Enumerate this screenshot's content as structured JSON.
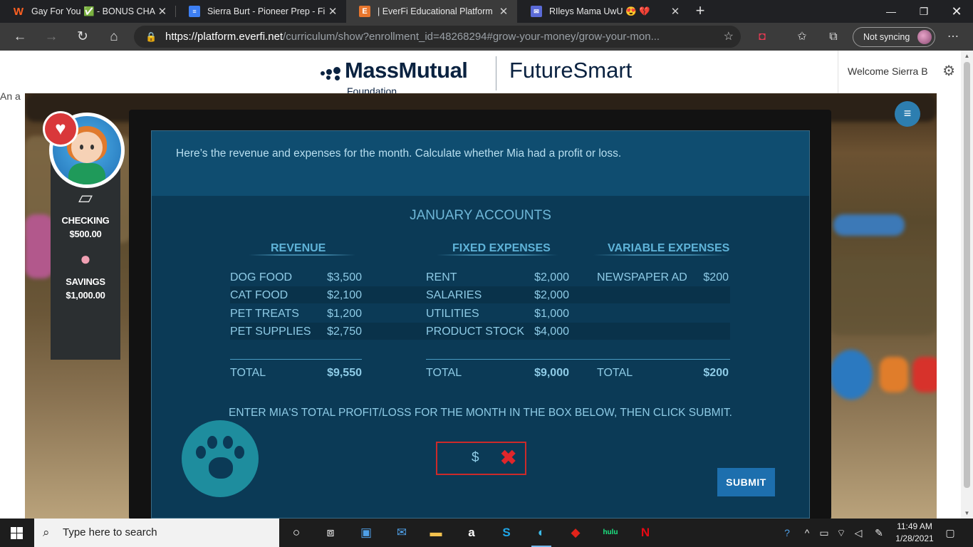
{
  "browser": {
    "tabs": [
      {
        "title": "Gay For You ✅ - BONUS CHAPT",
        "icon": "wattpad-icon"
      },
      {
        "title": "Sierra Burt - Pioneer Prep - Finan",
        "icon": "docs-icon"
      },
      {
        "title": "| EverFi Educational Platform",
        "icon": "everfi-icon"
      },
      {
        "title": "RIleys Mama UwU 😍 💔",
        "icon": "mail-icon"
      }
    ],
    "new_tab": "+",
    "url_host": "https://platform.everfi.net",
    "url_path": "/curriculum/show?enrollment_id=48268294#grow-your-money/grow-your-mon...",
    "sync_label": "Not syncing"
  },
  "header": {
    "logo_brand": "MassMutual",
    "logo_sub": "Foundation",
    "logo_program": "FutureSmart",
    "welcome": "Welcome Sierra B",
    "alt_text": "An a"
  },
  "game": {
    "checking_label": "CHECKING",
    "checking_amount": "$500.00",
    "savings_label": "SAVINGS",
    "savings_amount": "$1,000.00",
    "instruction": "Here’s the revenue and expenses for the month. Calculate whether Mia had a profit or loss.",
    "accounts_title": "JANUARY ACCOUNTS",
    "revenue": {
      "heading": "REVENUE",
      "rows": [
        {
          "label": "DOG FOOD",
          "value": "$3,500"
        },
        {
          "label": "CAT FOOD",
          "value": "$2,100"
        },
        {
          "label": "PET TREATS",
          "value": "$1,200"
        },
        {
          "label": "PET SUPPLIES",
          "value": "$2,750"
        }
      ],
      "total_label": "TOTAL",
      "total_value": "$9,550"
    },
    "fixed": {
      "heading": "FIXED EXPENSES",
      "rows": [
        {
          "label": "RENT",
          "value": "$2,000"
        },
        {
          "label": "SALARIES",
          "value": "$2,000"
        },
        {
          "label": "UTILITIES",
          "value": "$1,000"
        },
        {
          "label": "PRODUCT STOCK",
          "value": "$4,000"
        }
      ],
      "total_label": "TOTAL",
      "total_value": "$9,000"
    },
    "variable": {
      "heading": "VARIABLE EXPENSES",
      "rows": [
        {
          "label": "NEWSPAPER AD",
          "value": "$200"
        }
      ],
      "total_label": "TOTAL",
      "total_value": "$200"
    },
    "prompt": "ENTER MIA'S TOTAL PROFIT/LOSS FOR THE MONTH IN THE BOX BELOW, THEN CLICK SUBMIT.",
    "answer_prefix": "$",
    "answer_value": "",
    "submit_label": "SUBMIT"
  },
  "taskbar": {
    "search_placeholder": "Type here to search",
    "time": "11:49 AM",
    "date": "1/28/2021"
  },
  "colors": {
    "screen_bg": "#0b3a56",
    "heading": "#5fb3d8",
    "text": "#8ecbe6",
    "submit": "#1d6fae",
    "error": "#cc2a2a"
  }
}
